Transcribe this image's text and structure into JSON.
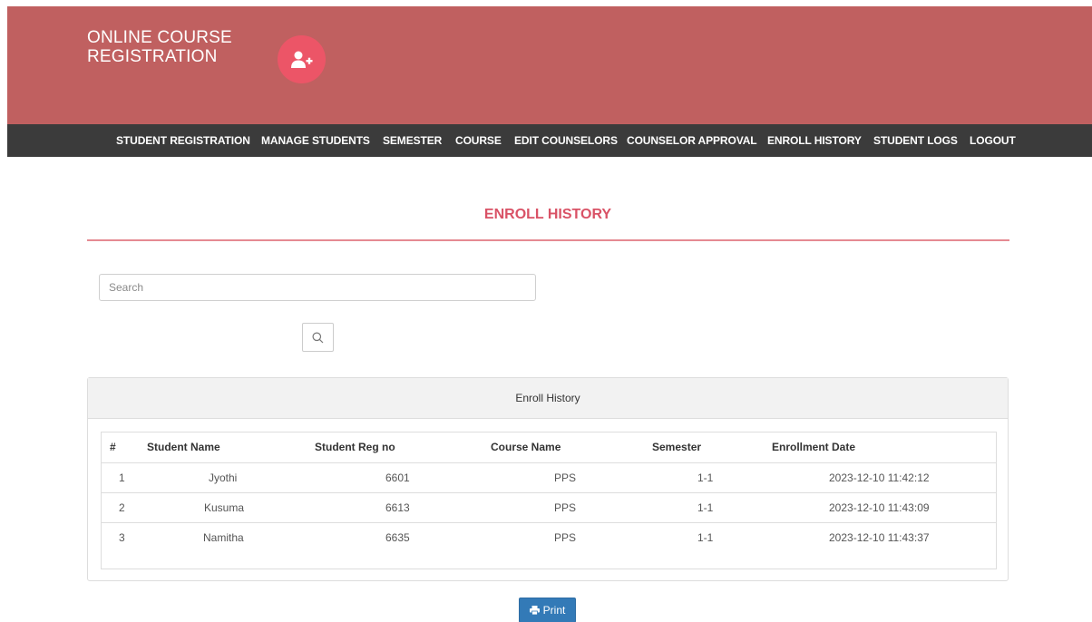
{
  "header": {
    "brand_line1": "ONLINE COURSE",
    "brand_line2": "REGISTRATION",
    "brand_icon": "user-plus-icon",
    "background_color": "#c06060",
    "icon_color": "#ec5567"
  },
  "nav": {
    "items": [
      "STUDENT REGISTRATION",
      "MANAGE STUDENTS",
      "SEMESTER",
      "COURSE",
      "EDIT COUNSELORS",
      "COUNSELOR APPROVAL",
      "ENROLL HISTORY",
      "STUDENT LOGS",
      "LOGOUT"
    ]
  },
  "page": {
    "title": "ENROLL HISTORY",
    "accent_color": "#d95266"
  },
  "search": {
    "placeholder": "Search",
    "value": "",
    "button_icon": "search-icon"
  },
  "panel": {
    "heading": "Enroll History"
  },
  "table": {
    "columns": [
      "#",
      "Student Name",
      "Student Reg no",
      "Course Name",
      "Semester",
      "Enrollment Date"
    ],
    "rows": [
      [
        "1",
        "Jyothi",
        "6601",
        "PPS",
        "1-1",
        "2023-12-10 11:42:12"
      ],
      [
        "2",
        "Kusuma",
        "6613",
        "PPS",
        "1-1",
        "2023-12-10 11:43:09"
      ],
      [
        "3",
        "Namitha",
        "6635",
        "PPS",
        "1-1",
        "2023-12-10 11:43:37"
      ]
    ]
  },
  "print_button": {
    "label": "Print",
    "icon": "printer-icon",
    "color": "#337ab7"
  }
}
